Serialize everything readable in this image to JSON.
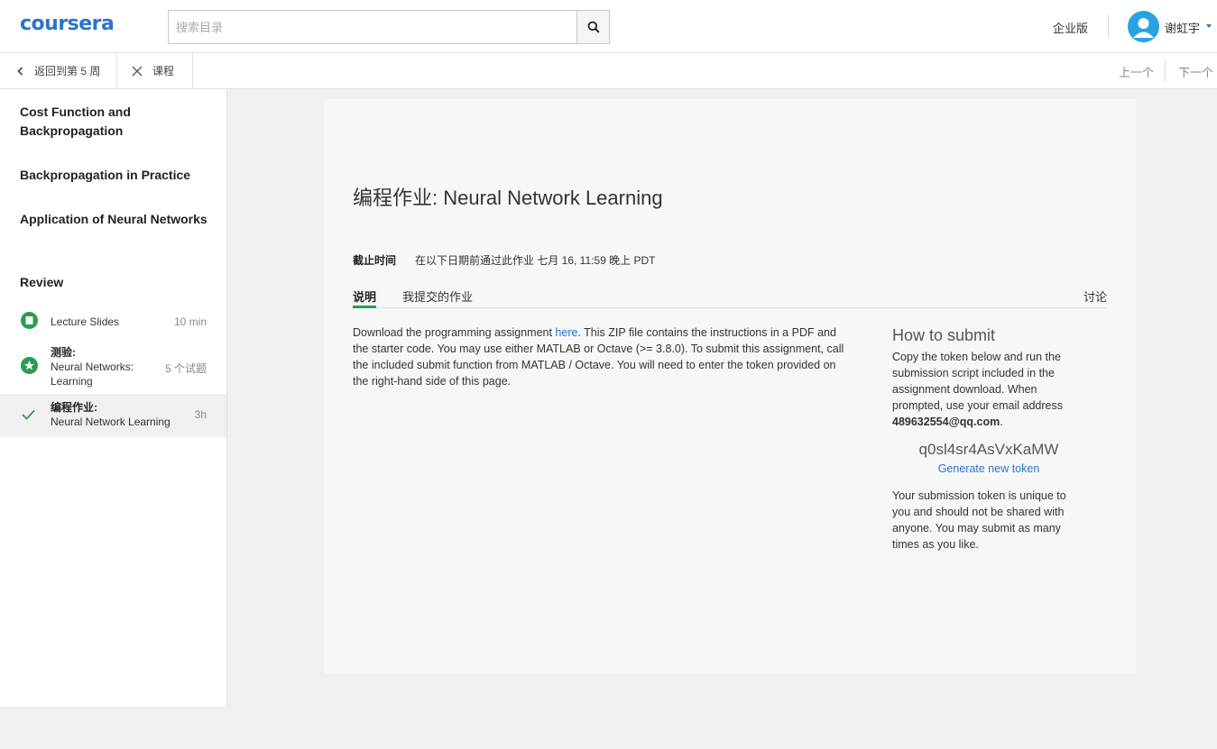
{
  "header": {
    "logo": "coursera",
    "search_placeholder": "搜索目录",
    "enterprise": "企业版",
    "username": "谢虹宇",
    "brand_color": "#2a73cc"
  },
  "subnav": {
    "back": "返回到第 5 周",
    "course": "课程",
    "prev": "上一个",
    "next": "下一个"
  },
  "sidebar": {
    "sections": [
      "Cost Function and Backpropagation",
      "Backpropagation in Practice",
      "Application of Neural Networks",
      "Review"
    ],
    "items": [
      {
        "type_label": "",
        "title": "Lecture Slides",
        "meta": "10 min",
        "icon": "slides-icon"
      },
      {
        "type_label": "测验:",
        "title": "Neural Networks: Learning",
        "meta": "5 个试题",
        "icon": "quiz-star-icon"
      },
      {
        "type_label": "编程作业:",
        "title": "Neural Network Learning",
        "meta": "3h",
        "icon": "check-icon"
      }
    ]
  },
  "main": {
    "title": "编程作业: Neural Network Learning",
    "deadline_label": "截止时间",
    "deadline_value": "在以下日期前通过此作业 七月 16, 11:59 晚上 PDT",
    "tabs": [
      "说明",
      "我提交的作业",
      "讨论"
    ],
    "desc_before": "Download the programming assignment ",
    "desc_link": "here",
    "desc_after": ". This ZIP file contains the instructions in a PDF and the starter code. You may use either MATLAB or Octave (>= 3.8.0). To submit this assignment, call the included submit function from MATLAB / Octave. You will need to enter the token provided on the right-hand side of this page.",
    "submit": {
      "title": "How to submit",
      "text": "Copy the token below and run the submission script included in the assignment download. When prompted, use your email address",
      "email": "489632554@qq.com",
      "email_suffix": ".",
      "token": "q0sl4sr4AsVxKaMW",
      "generate": "Generate new token",
      "note": "Your submission token is unique to you and should not be shared with anyone. You may submit as many times as you like."
    }
  }
}
